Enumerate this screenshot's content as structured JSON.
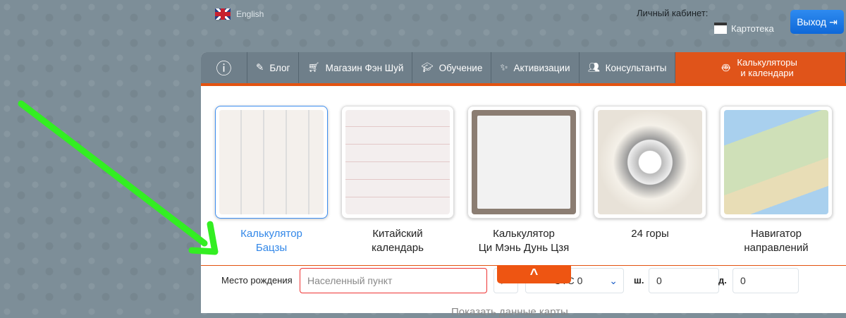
{
  "header": {
    "language": "English",
    "cabinet_label": "Личный кабинет:",
    "kartoteka": "Картотека",
    "exit_label": "Выход"
  },
  "tabs": [
    {
      "label": ""
    },
    {
      "label": "Блог"
    },
    {
      "label": "Магазин Фэн Шуй"
    },
    {
      "label": "Обучение"
    },
    {
      "label": "Активизации"
    },
    {
      "label": "Консультанты"
    },
    {
      "label": "Калькуляторы и календари"
    }
  ],
  "cards": [
    {
      "label1": "Калькулятор",
      "label2": "Бацзы"
    },
    {
      "label1": "Китайский",
      "label2": "календарь"
    },
    {
      "label1": "Калькулятор",
      "label2": "Ци Мэнь Дунь Цзя"
    },
    {
      "label1": "24 горы",
      "label2": ""
    },
    {
      "label1": "Навигатор",
      "label2": "направлений"
    }
  ],
  "form": {
    "birthplace_label": "Место рождения",
    "birthplace_placeholder": "Населенный пункт",
    "timezone": "UTC 0",
    "lat_label": "ш.",
    "lat": "0",
    "lon_label": "д.",
    "lon": "0",
    "show_map": "Показать данные карты"
  },
  "colors": {
    "accent": "#e35210",
    "selected": "#3287e8",
    "arrow": "#33ee22"
  }
}
